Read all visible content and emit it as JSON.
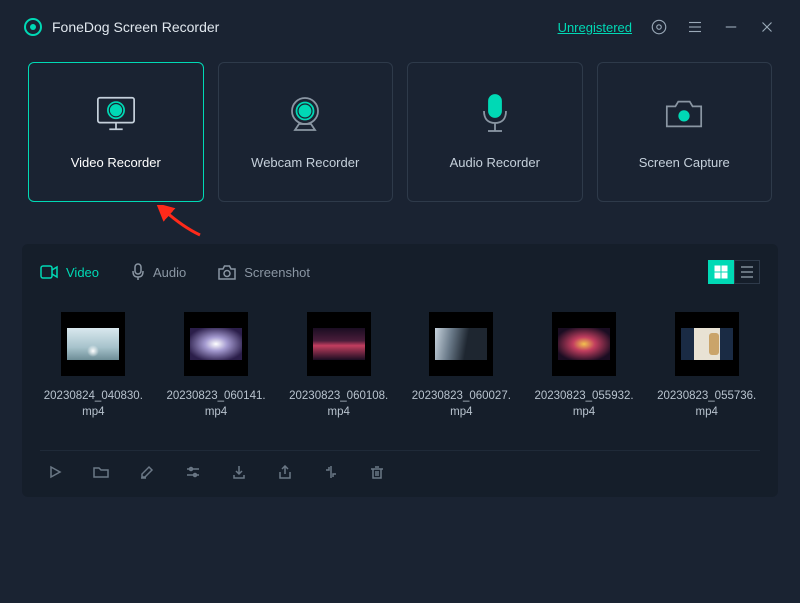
{
  "app": {
    "title": "FoneDog Screen Recorder"
  },
  "header": {
    "registration_label": "Unregistered"
  },
  "modes": {
    "video": "Video Recorder",
    "webcam": "Webcam Recorder",
    "audio": "Audio Recorder",
    "capture": "Screen Capture"
  },
  "library": {
    "tabs": {
      "video": "Video",
      "audio": "Audio",
      "screenshot": "Screenshot"
    },
    "files": [
      {
        "name": "20230824_040830.mp4"
      },
      {
        "name": "20230823_060141.mp4"
      },
      {
        "name": "20230823_060108.mp4"
      },
      {
        "name": "20230823_060027.mp4"
      },
      {
        "name": "20230823_055932.mp4"
      },
      {
        "name": "20230823_055736.mp4"
      }
    ]
  }
}
